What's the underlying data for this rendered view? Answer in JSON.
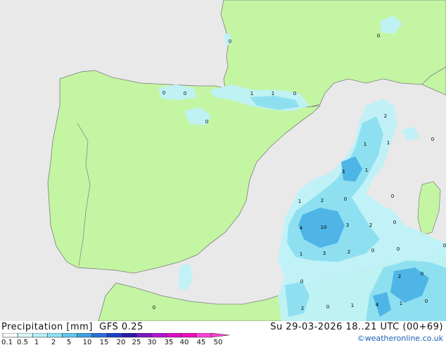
{
  "header": {
    "product": "Precipitation [mm]",
    "model": "GFS 0.25",
    "valid_time": "Su 29-03-2026 18..21 UTC (00+69)",
    "credit": "©weatheronline.co.uk"
  },
  "colors": {
    "sea": "#e9e9e9",
    "land": "#c4f5a3",
    "border": "#7d7d7d",
    "precip_light": "#bff2f8",
    "precip_mid": "#8ee0f0",
    "precip_heavy": "#4fb5e6"
  },
  "legend": {
    "labels": [
      "0.1",
      "0.5",
      "1",
      "2",
      "5",
      "10",
      "15",
      "20",
      "25",
      "30",
      "35",
      "40",
      "45",
      "50"
    ],
    "colors": [
      "#ffffff",
      "#d8f7fb",
      "#b7eff8",
      "#8fe3f3",
      "#5fc8ec",
      "#3aa1e4",
      "#2a6fd9",
      "#1e3fc8",
      "#2a1aa8",
      "#7a16c8",
      "#b414d0",
      "#d810c8",
      "#f00ac0",
      "#ff40d8"
    ]
  },
  "map_labels": [
    {
      "text": "0"
    },
    {
      "text": "0"
    },
    {
      "text": "0"
    },
    {
      "text": "0"
    },
    {
      "text": "0"
    },
    {
      "text": "1"
    },
    {
      "text": "1"
    },
    {
      "text": "0"
    },
    {
      "text": "2"
    },
    {
      "text": "1"
    },
    {
      "text": "1"
    },
    {
      "text": "0"
    },
    {
      "text": "3"
    },
    {
      "text": "1"
    },
    {
      "text": "0"
    },
    {
      "text": "1"
    },
    {
      "text": "2"
    },
    {
      "text": "0"
    },
    {
      "text": "4"
    },
    {
      "text": "10"
    },
    {
      "text": "3"
    },
    {
      "text": "2"
    },
    {
      "text": "0"
    },
    {
      "text": "1"
    },
    {
      "text": "3"
    },
    {
      "text": "2"
    },
    {
      "text": "0"
    },
    {
      "text": "0"
    },
    {
      "text": "0"
    },
    {
      "text": "0"
    },
    {
      "text": "2"
    },
    {
      "text": "0"
    },
    {
      "text": "0"
    },
    {
      "text": "4"
    },
    {
      "text": "1"
    },
    {
      "text": "0"
    },
    {
      "text": "2"
    },
    {
      "text": "1"
    },
    {
      "text": "0"
    }
  ]
}
